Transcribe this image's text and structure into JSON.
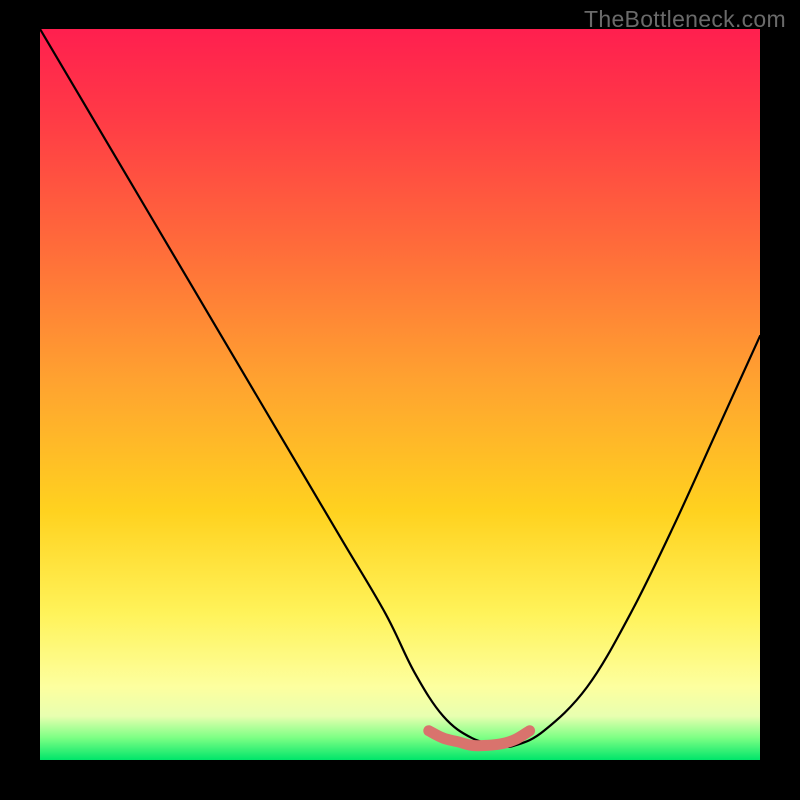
{
  "watermark": "TheBottleneck.com",
  "chart_data": {
    "type": "line",
    "title": "",
    "xlabel": "",
    "ylabel": "",
    "xlim": [
      0,
      100
    ],
    "ylim": [
      0,
      100
    ],
    "grid": false,
    "legend": false,
    "annotations": [],
    "series": [
      {
        "name": "black-curve",
        "color": "#000000",
        "x": [
          0,
          6,
          12,
          18,
          24,
          30,
          36,
          42,
          48,
          52,
          56,
          60,
          64,
          66,
          70,
          76,
          82,
          88,
          94,
          100
        ],
        "values": [
          100,
          90,
          80,
          70,
          60,
          50,
          40,
          30,
          20,
          12,
          6,
          3,
          2,
          2,
          4,
          10,
          20,
          32,
          45,
          58
        ]
      },
      {
        "name": "salmon-highlight-band",
        "color": "#d9736d",
        "x": [
          54,
          56,
          58,
          60,
          62,
          64,
          66,
          68
        ],
        "values": [
          4,
          3,
          2.5,
          2,
          2,
          2.2,
          2.8,
          4
        ]
      }
    ],
    "background_gradient": {
      "direction": "vertical",
      "stops": [
        {
          "pos": 0.0,
          "color": "#ff1f4f"
        },
        {
          "pos": 0.3,
          "color": "#ff6c3a"
        },
        {
          "pos": 0.66,
          "color": "#ffd21f"
        },
        {
          "pos": 0.9,
          "color": "#fdff9f"
        },
        {
          "pos": 1.0,
          "color": "#00e56a"
        }
      ]
    }
  }
}
